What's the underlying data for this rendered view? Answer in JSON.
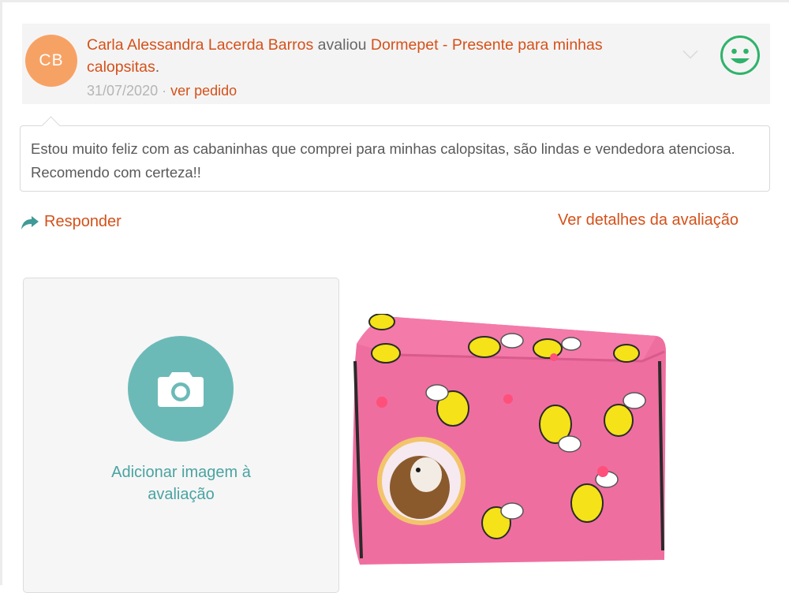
{
  "review": {
    "avatar_initials": "CB",
    "reviewer_name": "Carla Alessandra Lacerda Barros",
    "action_text": "avaliou",
    "product_name": "Dormepet - Presente para minhas calopsitas",
    "period": ".",
    "date": "31/07/2020",
    "separator": "·",
    "order_link": "ver pedido",
    "sentiment_icon": "smiley-happy-icon",
    "comment": "Estou muito feliz com as cabaninhas que comprei para minhas calopsitas, são lindas e vendedora atenciosa. Recomendo com certeza!!"
  },
  "actions": {
    "reply_label": "Responder",
    "details_label": "Ver detalhes da avaliação"
  },
  "images": {
    "add_label_line1": "Adicionar imagem à",
    "add_label_line2": "avaliação"
  },
  "colors": {
    "accent": "#d4511a",
    "teal": "#6cbab8",
    "avatar": "#f7a265",
    "smiley": "#2fb36b"
  }
}
